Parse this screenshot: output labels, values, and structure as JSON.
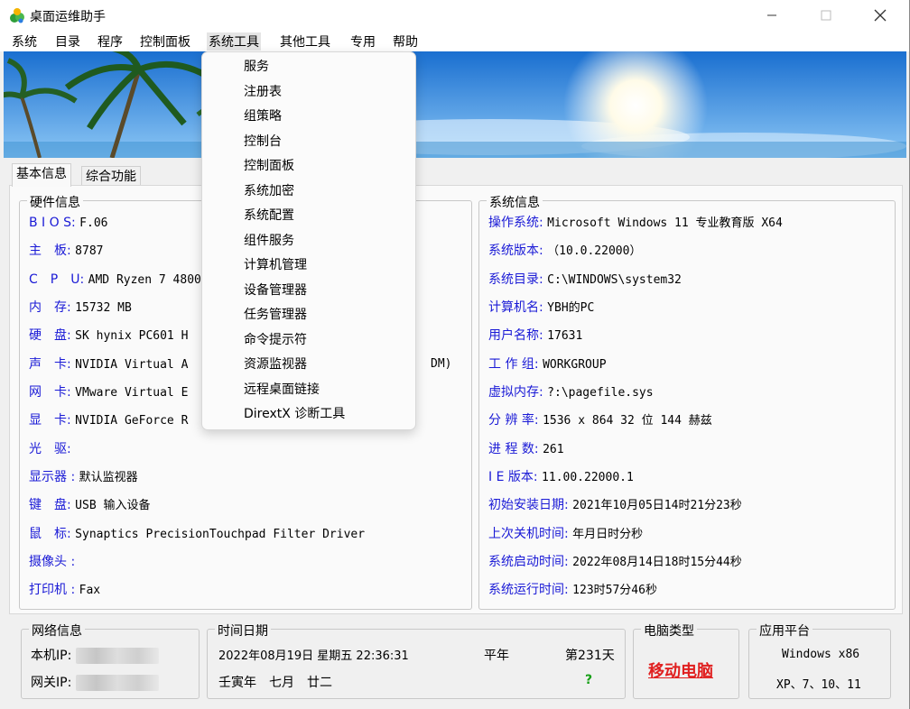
{
  "window": {
    "title": "桌面运维助手"
  },
  "menu": [
    "系统",
    "目录",
    "程序",
    "控制面板",
    "系统工具",
    "其他工具",
    "专用",
    "帮助"
  ],
  "dropdown": [
    "服务",
    "注册表",
    "组策略",
    "控制台",
    "控制面板",
    "系统加密",
    "系统配置",
    "组件服务",
    "计算机管理",
    "设备管理器",
    "任务管理器",
    "命令提示符",
    "资源监视器",
    "远程桌面链接",
    "DirextX 诊断工具"
  ],
  "tabs": [
    "基本信息",
    "综合功能"
  ],
  "hardware": {
    "title": "硬件信息",
    "rows": [
      {
        "label": "B I O S:",
        "value": "F.06"
      },
      {
        "label": "主　板:",
        "value": "8787"
      },
      {
        "label": "C　P　U:",
        "value": "AMD Ryzen 7 4800"
      },
      {
        "label": "内　存:",
        "value": "15732 MB"
      },
      {
        "label": "硬　盘:",
        "value": "SK hynix PC601 H"
      },
      {
        "label": "声　卡:",
        "value": "NVIDIA Virtual A"
      },
      {
        "label": "网　卡:",
        "value": "VMware Virtual E"
      },
      {
        "label": "显　卡:",
        "value": "NVIDIA GeForce R"
      },
      {
        "label": "光　驱:",
        "value": ""
      },
      {
        "label": "显示器 :",
        "value": "默认监视器"
      },
      {
        "label": "键　盘:",
        "value": "USB 输入设备"
      },
      {
        "label": "鼠　标:",
        "value": "Synaptics PrecisionTouchpad Filter Driver"
      },
      {
        "label": "摄像头 :",
        "value": ""
      },
      {
        "label": "打印机 :",
        "value": "Fax"
      }
    ],
    "sound_tail": "DM)"
  },
  "system": {
    "title": "系统信息",
    "rows": [
      {
        "label": "操作系统:",
        "value": "Microsoft Windows 11 专业教育版 X64"
      },
      {
        "label": "系统版本:",
        "value": "（10.0.22000）"
      },
      {
        "label": "系统目录:",
        "value": "C:\\WINDOWS\\system32"
      },
      {
        "label": "计算机名:",
        "value": "YBH的PC"
      },
      {
        "label": "用户名称:",
        "value": "17631"
      },
      {
        "label": "工 作 组:",
        "value": "WORKGROUP"
      },
      {
        "label": "虚拟内存:",
        "value": "?:\\pagefile.sys"
      },
      {
        "label": "分 辨 率:",
        "value": "1536 x 864 32 位 144 赫兹"
      },
      {
        "label": "进 程 数:",
        "value": "261"
      },
      {
        "label": "I E 版本:",
        "value": "11.00.22000.1"
      },
      {
        "label": "初始安装日期:",
        "value": "2021年10月05日14时21分23秒"
      },
      {
        "label": "上次关机时间:",
        "value": "年月日时分秒"
      },
      {
        "label": "系统启动时间:",
        "value": "2022年08月14日18时15分44秒"
      },
      {
        "label": "系统运行时间:",
        "value": "123时57分46秒"
      }
    ]
  },
  "network": {
    "title": "网络信息",
    "local_ip_label": "本机IP:",
    "gateway_ip_label": "网关IP:"
  },
  "datetime": {
    "title": "时间日期",
    "date": "2022年08月19日 星期五 22:36:31",
    "year_type": "平年",
    "day_of_year": "第231天",
    "lunar": "壬寅年　七月　廿二",
    "zodiac": "?"
  },
  "computer_type": {
    "title": "电脑类型",
    "value": "移动电脑"
  },
  "platform": {
    "title": "应用平台",
    "line1": "Windows x86",
    "line2": "XP、7、10、11"
  },
  "colors": {
    "label": "#1a1ad6",
    "mobile": "#e02020",
    "zodiac": "#18a018"
  }
}
